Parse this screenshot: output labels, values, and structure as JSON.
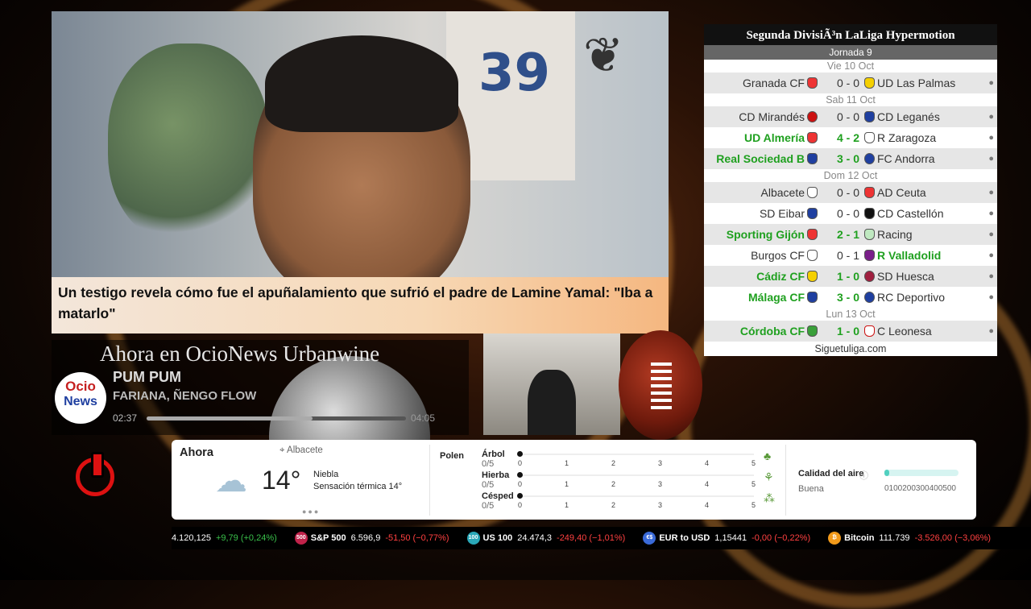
{
  "news": {
    "headline": "Un testigo revela cómo fue el apuñalamiento que sufrió el padre de Lamine Yamal: \"Iba a matarlo\"",
    "jersey_number": "39"
  },
  "league": {
    "title": "Segunda DivisiÃ³n LaLiga Hypermotion",
    "jornada": "Jornada 9",
    "days": {
      "d1": "Vie 10 Oct",
      "d2": "Sab 11 Oct",
      "d3": "Dom 12 Oct",
      "d4": "Lun 13 Oct"
    },
    "matches": [
      {
        "home": "Granada CF",
        "score": "0 - 0",
        "away": "UD Las Palmas"
      },
      {
        "home": "CD Mirandés",
        "score": "0 - 0",
        "away": "CD Leganés"
      },
      {
        "home": "UD Almería",
        "score": "4 - 2",
        "away": "R Zaragoza"
      },
      {
        "home": "Real Sociedad B",
        "score": "3 - 0",
        "away": "FC Andorra"
      },
      {
        "home": "Albacete",
        "score": "0 - 0",
        "away": "AD Ceuta"
      },
      {
        "home": "SD Eibar",
        "score": "0 - 0",
        "away": "CD Castellón"
      },
      {
        "home": "Sporting Gijón",
        "score": "2 - 1",
        "away": "Racing"
      },
      {
        "home": "Burgos CF",
        "score": "0 - 1",
        "away": "R Valladolid"
      },
      {
        "home": "Cádiz CF",
        "score": "1 - 0",
        "away": "SD Huesca"
      },
      {
        "home": "Málaga CF",
        "score": "3 - 0",
        "away": "RC Deportivo"
      },
      {
        "home": "Córdoba CF",
        "score": "1 - 0",
        "away": "C Leonesa"
      }
    ],
    "footer": "Siguetuliga.com"
  },
  "radio": {
    "now_playing": "Ahora en OcioNews Urbanwine",
    "logo_line1": "Ocio",
    "logo_line2": "News",
    "song": "PUM PUM",
    "artist": "FARIANA, ÑENGO FLOW",
    "elapsed": "02:37",
    "duration": "04:05",
    "progress": 0.64
  },
  "weather": {
    "now": "Ahora",
    "location": "Albacete",
    "temp": "14°",
    "condition": "Niebla",
    "feels_like": "Sensación térmica 14°",
    "pollen_label": "Polen",
    "pollen": [
      {
        "name": "Árbol",
        "value": "0/5",
        "icon": "tree-icon"
      },
      {
        "name": "Hierba",
        "value": "0/5",
        "icon": "grass-icon"
      },
      {
        "name": "Césped",
        "value": "0/5",
        "icon": "lawn-icon"
      }
    ],
    "scale": [
      "0",
      "1",
      "2",
      "3",
      "4",
      "5"
    ],
    "air_quality_label": "Calidad del aire",
    "air_quality_value": "Buena",
    "air_scale": "0100200300400500"
  },
  "ticker": [
    {
      "badge": "",
      "name": "",
      "value": "4.120,125",
      "change": "+9,79 (+0,24%)",
      "dir": "up",
      "color": "#000000"
    },
    {
      "badge": "500",
      "name": "S&P 500",
      "value": "6.596,9",
      "change": "-51,50 (−0,77%)",
      "dir": "down",
      "color": "#c0224a"
    },
    {
      "badge": "100",
      "name": "US 100",
      "value": "24.474,3",
      "change": "-249,40 (−1,01%)",
      "dir": "down",
      "color": "#2aa8b8"
    },
    {
      "badge": "€$",
      "name": "EUR to USD",
      "value": "1,15441",
      "change": "-0,00 (−0,22%)",
      "dir": "down",
      "color": "#3a6ad8"
    },
    {
      "badge": "₿",
      "name": "Bitcoin",
      "value": "111.739",
      "change": "-3.526,00 (−3,06%)",
      "dir": "down",
      "color": "#f29a1a"
    }
  ]
}
